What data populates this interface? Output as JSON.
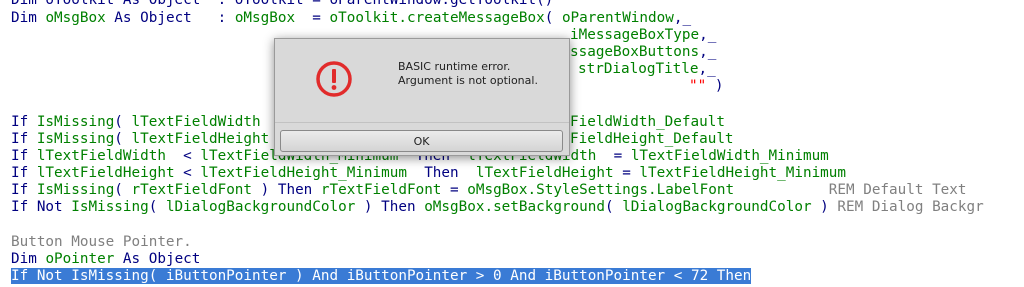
{
  "dialog": {
    "icon": "error-icon",
    "line1": "BASIC runtime error.",
    "line2": "Argument is not optional.",
    "ok_label": "OK",
    "icon_color": "#e12b2b"
  },
  "code": {
    "l0a": "Dim oToolkit As Object",
    "l0b": "  : oToolkit = oParentWindow.getToolkit()",
    "l1_kw1": "Dim ",
    "l1_id1": "oMsgBox",
    "l1_kw2": " As Object   : ",
    "l1_id2": "oMsgBox",
    "l1_op1": "  = ",
    "l1_id3": "oToolkit.createMessageBox",
    "l1_op2": "( ",
    "l1_id4": "oParentWindow",
    "l1_op3": ",_",
    "l2_id": "iMessageBoxType",
    "l2_op": ",_",
    "l3_id": "ssageBoxButtons",
    "l3_op": ",_",
    "l4_id": "strDialogTitle",
    "l4_op": ",_",
    "l5_str": "\"\"",
    "l5_op": " )",
    "l6_kw1": "If ",
    "l6_id1": "IsMissing",
    "l6_op1": "( ",
    "l6_id2": "lTextFieldWidth",
    "l6_id3": "FieldWidth_Default",
    "l7_kw1": "If ",
    "l7_id1": "IsMissing",
    "l7_op1": "( ",
    "l7_id2": "lTextFieldHeight",
    "l7_id3": "FieldHeight_Default",
    "l8_kw1": "If ",
    "l8_id1": "lTextFieldWidth",
    "l8_op1": "  < ",
    "l8_id2": "lTextFieldWidth_Minimum",
    "l8_kw2": "  Then  ",
    "l8_id3": "lTextFieldWidth",
    "l8_op2": "  = ",
    "l8_id4": "lTextFieldWidth_Minimum",
    "l9_kw1": "If ",
    "l9_id1": "lTextFieldHeight",
    "l9_op1": " < ",
    "l9_id2": "lTextFieldHeight_Minimum",
    "l9_kw2": "  Then  ",
    "l9_id3": "lTextFieldHeight",
    "l9_op2": " = ",
    "l9_id4": "lTextFieldHeight_Minimum",
    "l10_kw1": "If ",
    "l10_id1": "IsMissing",
    "l10_op1": "( ",
    "l10_id2": "rTextFieldFont",
    "l10_op2": " ) ",
    "l10_kw2": "Then ",
    "l10_id3": "rTextFieldFont",
    "l10_op3": " = ",
    "l10_id4": "oMsgBox.StyleSettings.LabelFont",
    "l10_cm": "           REM Default Text",
    "l11_kw1": "If Not ",
    "l11_id1": "IsMissing",
    "l11_op1": "( ",
    "l11_id2": "lDialogBackgroundColor",
    "l11_op2": " ) ",
    "l11_kw2": "Then ",
    "l11_id3": "oMsgBox.setBackground",
    "l11_op3": "( ",
    "l11_id4": "lDialogBackgroundColor",
    "l11_op4": " ) ",
    "l11_cm": "REM Dialog Backgr",
    "l12_cm": "Button Mouse Pointer.",
    "l13_kw1": "Dim ",
    "l13_id1": "oPointer",
    "l13_kw2": " As Object",
    "l14_sel": "If Not IsMissing( iButtonPointer ) And iButtonPointer > 0 And iButtonPointer < 72 Then"
  },
  "colors": {
    "keyword": "#000080",
    "identifier": "#008000",
    "string": "#ff0000",
    "comment": "#808080",
    "selection": "#3a7bd5"
  }
}
